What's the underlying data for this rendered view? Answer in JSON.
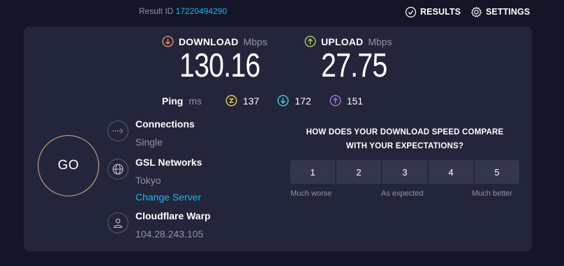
{
  "header": {
    "result_label": "Result ID",
    "result_id": "17220494290",
    "results_label": "RESULTS",
    "settings_label": "SETTINGS"
  },
  "download": {
    "label": "DOWNLOAD",
    "unit": "Mbps",
    "value": "130.16",
    "color": "#f08a6c"
  },
  "upload": {
    "label": "UPLOAD",
    "unit": "Mbps",
    "value": "27.75",
    "color": "#a6d65a"
  },
  "ping": {
    "label": "Ping",
    "unit": "ms",
    "idle": {
      "value": "137",
      "color": "#e8d25a"
    },
    "download": {
      "value": "172",
      "color": "#3fd0d8"
    },
    "upload": {
      "value": "151",
      "color": "#a77ad8"
    }
  },
  "go_label": "GO",
  "connections": {
    "title": "Connections",
    "value": "Single"
  },
  "server": {
    "title": "GSL Networks",
    "location": "Tokyo",
    "change_label": "Change Server"
  },
  "host": {
    "title": "Cloudflare Warp",
    "ip": "104.28.243.105"
  },
  "survey": {
    "question_line1": "HOW DOES YOUR DOWNLOAD SPEED COMPARE",
    "question_line2": "WITH YOUR EXPECTATIONS?",
    "options": [
      "1",
      "2",
      "3",
      "4",
      "5"
    ],
    "scale_low": "Much worse",
    "scale_mid": "As expected",
    "scale_high": "Much better"
  },
  "icons": {
    "results": "check-circle-icon",
    "settings": "gear-icon",
    "download": "arrow-down-circle-icon",
    "upload": "arrow-up-circle-icon",
    "connections": "dotted-arrow-icon",
    "server": "globe-icon",
    "host": "user-icon"
  }
}
